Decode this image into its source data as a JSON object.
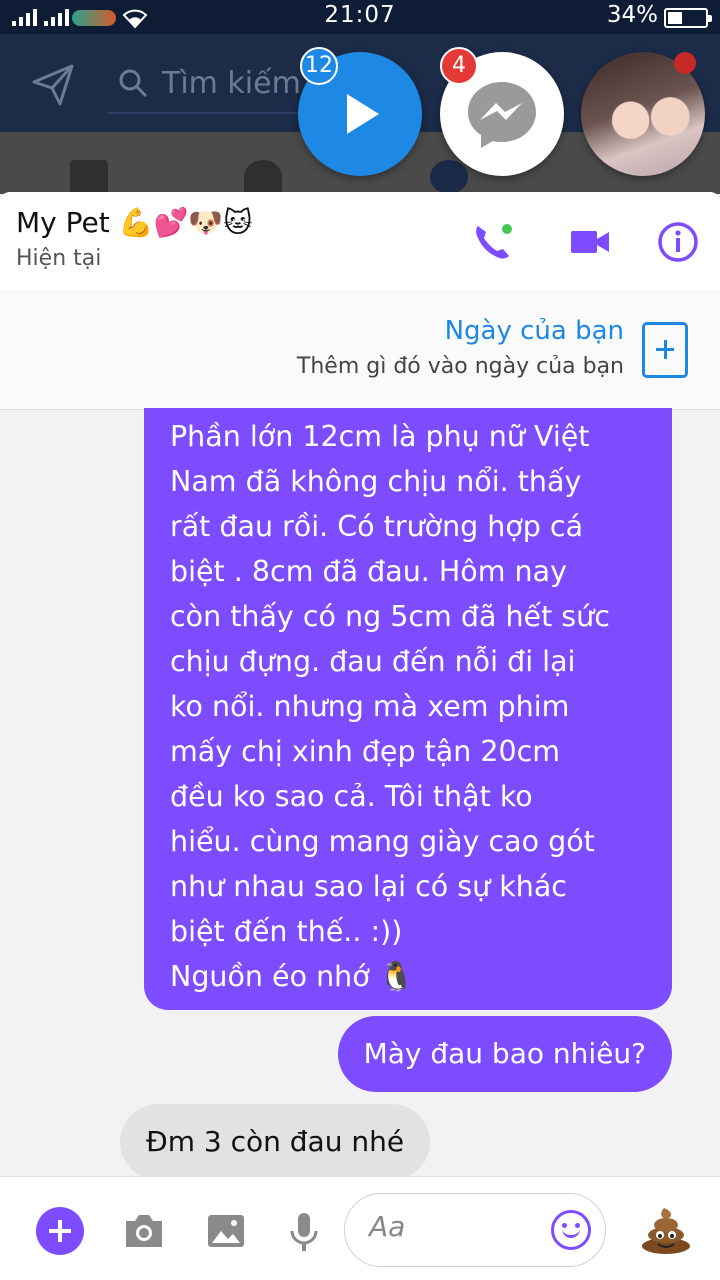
{
  "status_bar": {
    "time": "21:07",
    "battery_percent": "34%",
    "battery_level": 0.34,
    "carrier_logo": "viettel-logo",
    "icons": [
      "signal-icon",
      "signal-icon",
      "wifi-icon",
      "battery-icon"
    ]
  },
  "background_app": {
    "search_placeholder": "Tìm kiếm",
    "icons": [
      "send-icon",
      "search-icon",
      "news-icon",
      "people-icon",
      "globe-icon"
    ]
  },
  "chat_heads": {
    "video_badge": "12",
    "messenger_badge": "4"
  },
  "chat": {
    "title": "My Pet 💪💕🐶🐱",
    "status": "Hiện tại",
    "icons": [
      "phone-icon",
      "video-call-icon",
      "info-icon"
    ]
  },
  "day_banner": {
    "title": "Ngày của bạn",
    "subtitle": "Thêm gì đó vào ngày của bạn"
  },
  "messages": {
    "long_lines": [
      "Phần lớn 12cm là phụ nữ Việt",
      "Nam đã không chịu nổi. thấy",
      "rất đau rồi. Có trường hợp cá",
      "biệt . 8cm đã đau. Hôm nay",
      "còn thấy có ng 5cm đã hết sức",
      "chịu đựng. đau đến nỗi đi lại",
      "ko nổi. nhưng mà xem phim",
      "mấy chị xinh đẹp tận 20cm",
      "đều ko sao cả. Tôi thật ko",
      "hiểu. cùng mang giày cao gót",
      "như nhau sao lại có sự khác",
      "biệt đến thế.. :))",
      "Nguồn éo nhớ 🐧"
    ],
    "sent_short": "Mày đau bao nhiêu?",
    "received": "Đm 3 còn đau nhé"
  },
  "composer": {
    "placeholder": "Aa",
    "icons": [
      "plus-icon",
      "camera-icon",
      "image-icon",
      "mic-icon",
      "emoji-icon",
      "poop-icon"
    ],
    "accent": "#7d4cff"
  },
  "colors": {
    "accent_purple": "#7d4cff",
    "messenger_blue": "#1e88e5",
    "header_navy": "#1c2b48"
  }
}
